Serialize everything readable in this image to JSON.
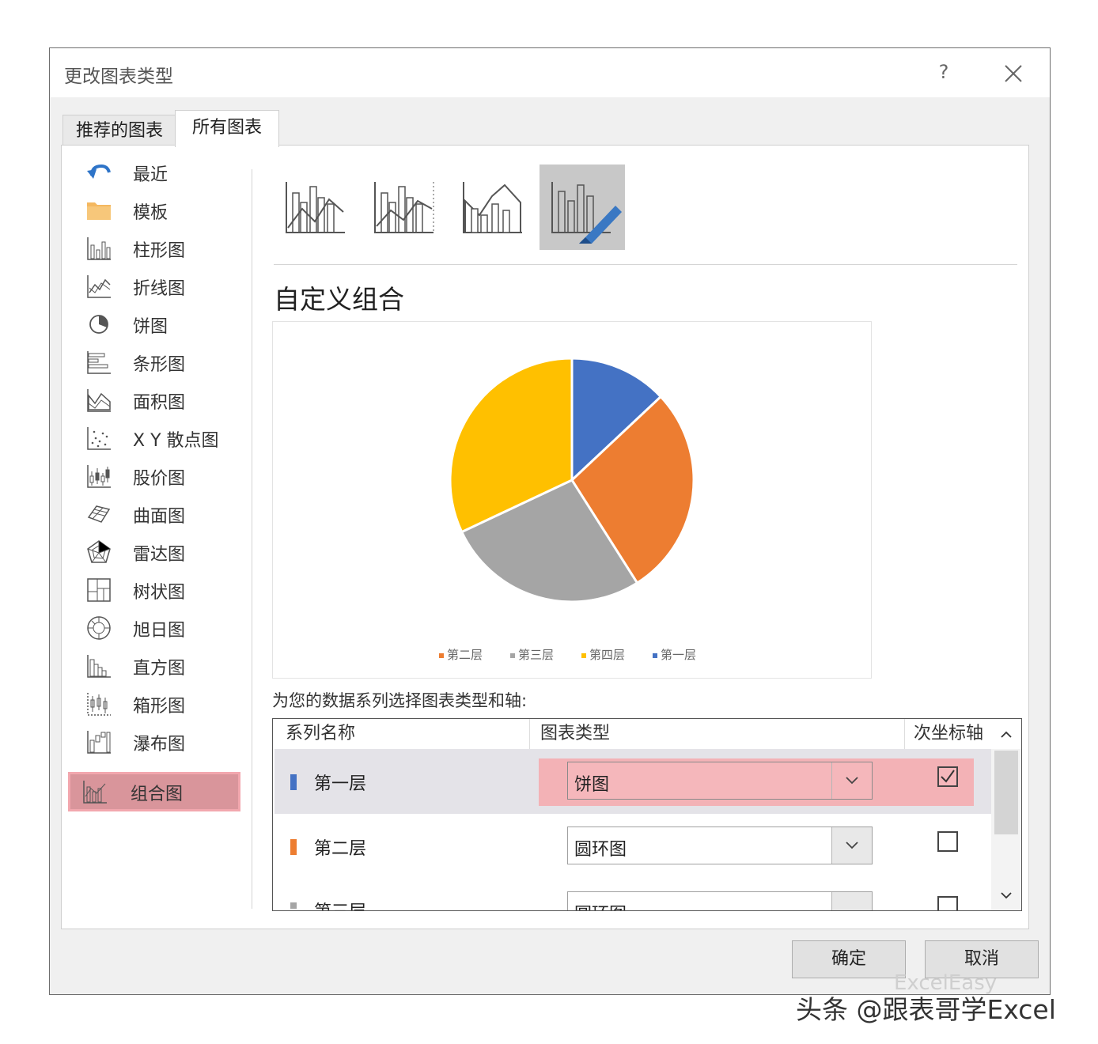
{
  "dialog": {
    "title": "更改图表类型",
    "help": "?",
    "tabs": [
      "推荐的图表",
      "所有图表"
    ]
  },
  "categories": [
    "最近",
    "模板",
    "柱形图",
    "折线图",
    "饼图",
    "条形图",
    "面积图",
    "X Y 散点图",
    "股价图",
    "曲面图",
    "雷达图",
    "树状图",
    "旭日图",
    "直方图",
    "箱形图",
    "瀑布图",
    "组合图"
  ],
  "selected_category": "组合图",
  "subtypes": [
    {
      "icon": "clustered-column-line-icon"
    },
    {
      "icon": "clustered-column-line-secondary-axis-icon"
    },
    {
      "icon": "stacked-area-clustered-column-icon"
    },
    {
      "icon": "custom-combination-icon"
    }
  ],
  "combo_title": "自定义组合",
  "chart_data": {
    "type": "pie",
    "categories": [
      "第一层",
      "第二层",
      "第三层",
      "第四层"
    ],
    "values": [
      13,
      28,
      27,
      32
    ],
    "colors": [
      "#4472c4",
      "#ed7d31",
      "#a5a5a5",
      "#ffc000"
    ],
    "legend": [
      "第二层",
      "第三层",
      "第四层",
      "第一层"
    ],
    "legend_colors": [
      "#ed7d31",
      "#a5a5a5",
      "#ffc000",
      "#4472c4"
    ],
    "legend_position": "bottom"
  },
  "prompt": "为您的数据系列选择图表类型和轴:",
  "table": {
    "headers": [
      "系列名称",
      "图表类型",
      "次坐标轴"
    ],
    "rows": [
      {
        "name": "第一层",
        "type": "饼图",
        "secondary": true,
        "color": "#4472c4"
      },
      {
        "name": "第二层",
        "type": "圆环图",
        "secondary": false,
        "color": "#ed7d31"
      },
      {
        "name": "第三层",
        "type": "圆环图",
        "secondary": false,
        "color": "#a5a5a5"
      }
    ]
  },
  "buttons": {
    "ok": "确定",
    "cancel": "取消"
  },
  "watermark": {
    "faint": "ExcelEasy",
    "main": "头条 @跟表哥学Excel"
  }
}
